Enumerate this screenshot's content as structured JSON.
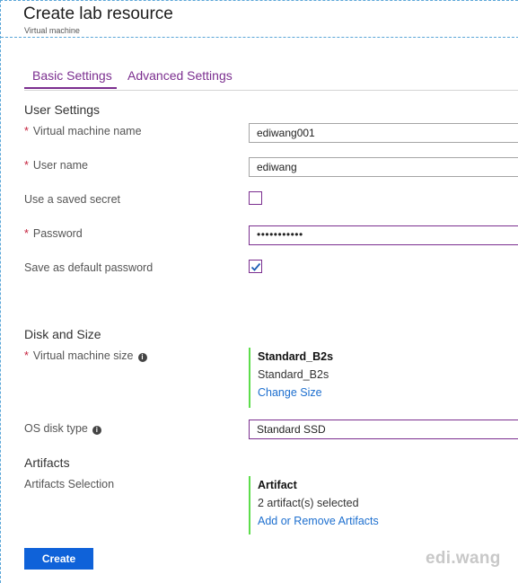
{
  "header": {
    "title": "Create lab resource",
    "subtitle": "Virtual machine"
  },
  "tabs": [
    {
      "label": "Basic Settings",
      "active": true
    },
    {
      "label": "Advanced Settings",
      "active": false
    }
  ],
  "user_settings": {
    "section_title": "User Settings",
    "vm_name": {
      "label": "Virtual machine name",
      "required": "*",
      "value": "ediwang001"
    },
    "user_name": {
      "label": "User name",
      "required": "*",
      "value": "ediwang"
    },
    "saved_secret": {
      "label": "Use a saved secret",
      "checked": false
    },
    "password": {
      "label": "Password",
      "required": "*",
      "value": "•••••••••••"
    },
    "default_password": {
      "label": "Save as default password",
      "checked": true
    }
  },
  "disk_size": {
    "section_title": "Disk and Size",
    "vm_size": {
      "label": "Virtual machine size",
      "required": "*",
      "info_icon": "i",
      "title": "Standard_B2s",
      "value": "Standard_B2s",
      "link": "Change Size"
    },
    "os_disk": {
      "label": "OS disk type",
      "info_icon": "i",
      "value": "Standard SSD"
    }
  },
  "artifacts": {
    "section_title": "Artifacts",
    "selection": {
      "label": "Artifacts Selection",
      "title": "Artifact",
      "value": "2 artifact(s) selected",
      "link": "Add or Remove Artifacts"
    }
  },
  "footer": {
    "create_label": "Create",
    "watermark": "edi.wang"
  },
  "colors": {
    "accent": "#7b2e8f",
    "primary_button": "#0f62d9",
    "link": "#1d6fcf",
    "required": "#c41e3a",
    "summary_bar": "#5ddd4b"
  }
}
